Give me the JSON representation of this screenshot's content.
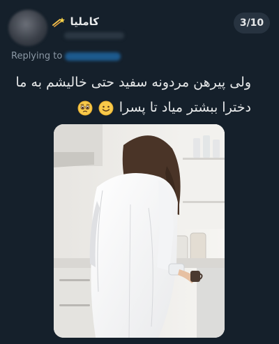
{
  "header": {
    "page_indicator": "3/10",
    "display_name": "کاملیا"
  },
  "reply": {
    "prefix": "Replying to"
  },
  "tweet": {
    "lines": [
      "ولی پیرهن مردونه سفید حتی خالیشم به ما",
      "دخترا ببشتر میاد تا پسرا"
    ],
    "emojis": [
      "pleading-face",
      "slightly-smiling-face"
    ]
  },
  "media": {
    "description_icon": "kitchen-photo"
  }
}
